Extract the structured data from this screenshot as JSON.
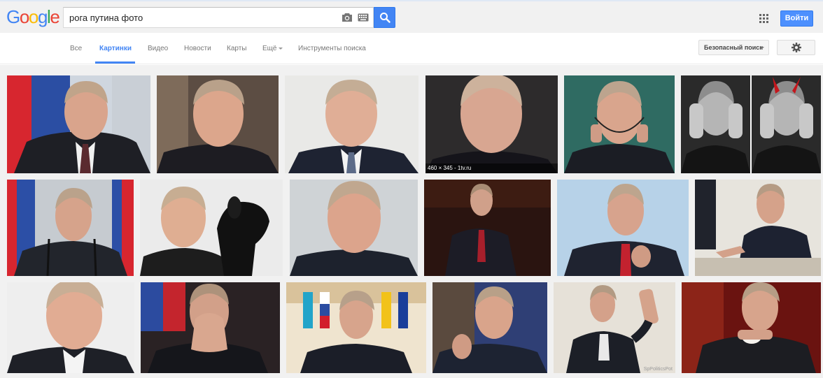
{
  "logo": {
    "letters": [
      "G",
      "o",
      "o",
      "g",
      "l",
      "e"
    ],
    "colors": [
      "#4285f4",
      "#ea4335",
      "#fbbc05",
      "#4285f4",
      "#34a853",
      "#ea4335"
    ]
  },
  "search": {
    "query": "рога путина фото"
  },
  "header": {
    "login_label": "Войти"
  },
  "nav": {
    "tabs": [
      {
        "label": "Все"
      },
      {
        "label": "Картинки"
      },
      {
        "label": "Видео"
      },
      {
        "label": "Новости"
      },
      {
        "label": "Карты"
      },
      {
        "label": "Ещё"
      },
      {
        "label": "Инструменты поиска"
      }
    ],
    "safe_search_label": "Безопасный поиск"
  },
  "results": {
    "hover_caption": "460 × 345 - 1tv.ru",
    "watermark": "SpPoliticsPot"
  },
  "colors": {
    "accent": "#4285f4",
    "nav_text": "#777777",
    "header_bg": "#f1f1f1"
  }
}
